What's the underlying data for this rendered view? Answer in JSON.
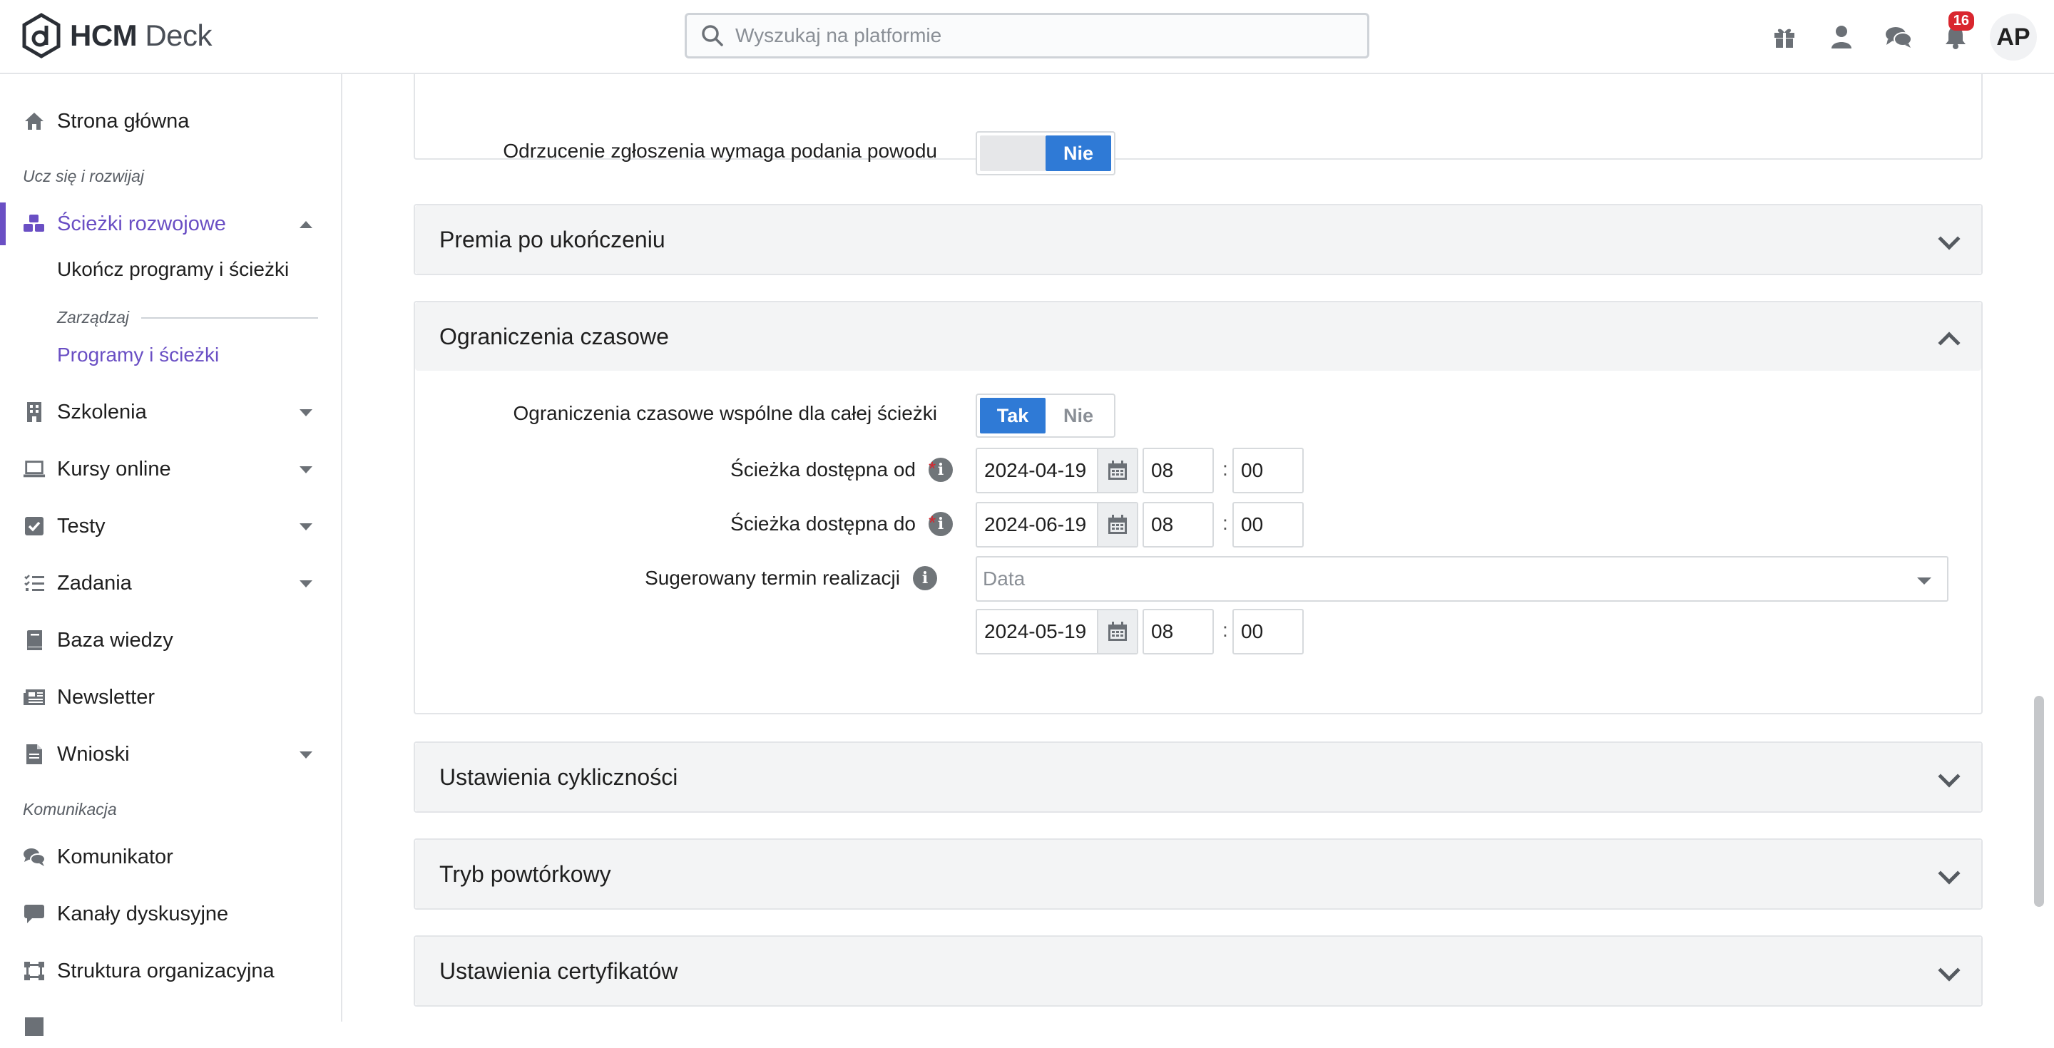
{
  "app": {
    "logo_bold": "HCM",
    "logo_light": "Deck"
  },
  "search": {
    "placeholder": "Wyszukaj na platformie"
  },
  "topbar": {
    "icons": [
      "gift-icon",
      "user-icon",
      "chat-icon",
      "bell-icon"
    ],
    "notifications_count": "16",
    "avatar_initials": "AP"
  },
  "sidebar": {
    "home": "Strona główna",
    "section_learn": "Ucz się i rozwijaj",
    "paths": "Ścieżki rozwojowe",
    "paths_sub_complete": "Ukończ programy i ścieżki",
    "paths_sub_manage_label": "Zarządzaj",
    "paths_sub_programs": "Programy i ścieżki",
    "trainings": "Szkolenia",
    "courses": "Kursy online",
    "tests": "Testy",
    "tasks": "Zadania",
    "knowledge": "Baza wiedzy",
    "newsletter": "Newsletter",
    "requests": "Wnioski",
    "section_comm": "Komunikacja",
    "messenger": "Komunikator",
    "channels": "Kanały dyskusyjne",
    "org_structure": "Struktura organizacyjna"
  },
  "panels": {
    "rejection": {
      "label": "Odrzucenie zgłoszenia wymaga podania powodu",
      "toggle_no": "Nie"
    },
    "bonus": {
      "title": "Premia po ukończeniu"
    },
    "time_limits": {
      "title": "Ograniczenia czasowe",
      "shared_label": "Ograniczenia czasowe wspólne dla całej ścieżki",
      "toggle_yes": "Tak",
      "toggle_no": "Nie",
      "available_from_label": "Ścieżka dostępna od",
      "available_from_date": "2024-04-19",
      "available_from_hour": "08",
      "available_from_minute": "00",
      "available_to_label": "Ścieżka dostępna do",
      "available_to_date": "2024-06-19",
      "available_to_hour": "08",
      "available_to_minute": "00",
      "suggested_label": "Sugerowany termin realizacji",
      "suggested_select": "Data",
      "suggested_date": "2024-05-19",
      "suggested_hour": "08",
      "suggested_minute": "00",
      "required_mark": "*",
      "time_separator": ":"
    },
    "cyclic": {
      "title": "Ustawienia cykliczności"
    },
    "repeat": {
      "title": "Tryb powtórkowy"
    },
    "certificates": {
      "title": "Ustawienia certyfikatów"
    }
  },
  "colors": {
    "accent": "#6a4fc4",
    "toggle_on": "#2f7ad6",
    "badge": "#d9262e"
  }
}
